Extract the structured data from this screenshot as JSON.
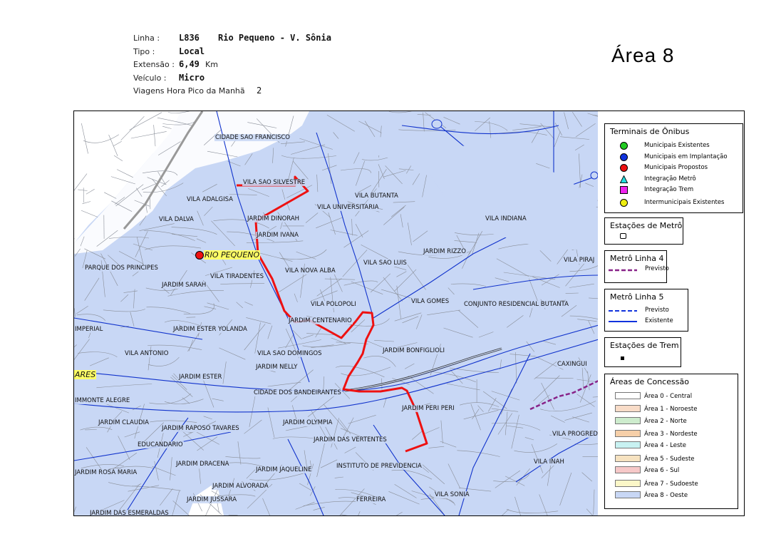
{
  "header": {
    "linha_label": "Linha :",
    "linha_code": "L836",
    "linha_name": "Rio Pequeno -  V. Sônia",
    "tipo_label": "Tipo :",
    "tipo_value": "Local",
    "extensao_label": "Extensão :",
    "extensao_value": "6,49",
    "extensao_unit": "Km",
    "veiculo_label": "Veículo :",
    "veiculo_value": "Micro",
    "viagens_label": "Viagens Hora Pico da Manhã",
    "viagens_value": "2"
  },
  "area_title": "Área  8",
  "map": {
    "route_color": "#ee1111",
    "water_color": "#c8d7f5",
    "labels": {
      "cidade_sao_francisco": "CIDADE SAO FRANCISCO",
      "vila_sao_silvestre": "VILA SAO SILVESTRE",
      "vila_adalgisa": "VILA ADALGISA",
      "vila_butanta": "VILA BUTANTA",
      "vila_universitaria": "VILA UNIVERSITARIA",
      "vila_dalva": "VILA DALVA",
      "jardim_dinorah": "JARDIM DINORAH",
      "vila_indiana": "VILA INDIANA",
      "jardim_ivana": "JARDIM IVANA",
      "jardim_rizzo": "JARDIM RIZZO",
      "rio_pequeno": "RIO PEQUENO",
      "vila_pirajussara": "VILA PIRAJ",
      "parque_dos_principes": "PARQUE DOS PRINCIPES",
      "vila_nova_alba": "VILA NOVA ALBA",
      "vila_sao_luis": "VILA SAO LUIS",
      "vila_tiradentes": "VILA TIRADENTES",
      "jardim_sarah": "JARDIM SARAH",
      "vila_polopoli": "VILA POLOPOLI",
      "vila_gomes": "VILA GOMES",
      "conjunto_butanta": "CONJUNTO RESIDENCIAL BUTANTA",
      "imperial": "IMPERIAL",
      "jardim_ester_yolanda": "JARDIM ESTER YOLANDA",
      "jardim_centenario": "JARDIM CENTENARIO",
      "vila_antonio": "VILA ANTONIO",
      "vila_sao_domingos": "VILA SAO DOMINGOS",
      "jardim_bonfiglioli": "JARDIM BONFIGLIOLI",
      "jardim_nelly": "JARDIM NELLY",
      "caxingui": "CAXINGUI",
      "tavares": "ARES",
      "jardim_ester": "JARDIM ESTER",
      "cidade_dos_bandeirantes": "CIDADE DOS BANDEIRANTES",
      "monte_alegre": "IMMONTE ALEGRE",
      "jardim_peri_peri": "JARDIM PERI PERI",
      "jardim_claudia": "JARDIM CLAUDIA",
      "jardim_raposo_tavares": "JARDIM RAPOSO TAVARES",
      "jardim_olympia": "JARDIM OLYMPIA",
      "vila_progredior": "VILA PROGRED",
      "educandario": "EDUCANDARIO",
      "jardim_das_vertentes": "JARDIM DAS VERTENTES",
      "jardim_dracena": "JARDIM DRACENA",
      "vila_inah": "VILA INAH",
      "jardim_rosa_maria": "JARDIM ROSA MARIA",
      "jardim_jaqueline": "JARDIM JAQUELINE",
      "instituto_previdencia": "INSTITUTO DE PREVIDENCIA",
      "jardim_alvorada": "JARDIM ALVORADA",
      "vila_sonia": "VILA SONIA",
      "jardim_jussara": "JARDIM JUSSARA",
      "ferreira": "FERREIRA",
      "jardim_das_esmeraldas": "JARDIM DAS ESMERALDAS"
    }
  },
  "legend": {
    "terminais": {
      "title": "Terminais de Ônibus",
      "items": [
        {
          "label": "Municipais Existentes",
          "color": "#22cc22",
          "icon": "circle-icon"
        },
        {
          "label": "Municipais em Implantação",
          "color": "#1133dd",
          "icon": "circle-icon"
        },
        {
          "label": "Municipais Propostos",
          "color": "#ee1111",
          "icon": "circle-icon"
        },
        {
          "label": "Integração Metrô",
          "color": "#22dddd",
          "icon": "triangle-icon"
        },
        {
          "label": "Integração Trem",
          "color": "#ee22ee",
          "icon": "square-icon"
        },
        {
          "label": "Intermunicipais Existentes",
          "color": "#eeee11",
          "icon": "circle-icon"
        }
      ]
    },
    "estacoes_metro": {
      "title": "Estações de Metrô"
    },
    "metro_linha4": {
      "title": "Metrô Linha 4",
      "items": [
        {
          "label": "Previsto",
          "color": "#882288"
        }
      ]
    },
    "metro_linha5": {
      "title": "Metrô Linha 5",
      "items": [
        {
          "label": "Previsto",
          "color": "#1133dd"
        },
        {
          "label": "Existente",
          "color": "#1133dd"
        }
      ]
    },
    "estacoes_trem": {
      "title": "Estações de Trem"
    },
    "areas": {
      "title": "Áreas de Concessão",
      "items": [
        {
          "label": "Área 0 - Central",
          "color": "#ffffff"
        },
        {
          "label": "Área 1 - Noroeste",
          "color": "#f8dcc8"
        },
        {
          "label": "Área 2 - Norte",
          "color": "#cdeccd"
        },
        {
          "label": "Área 3 - Nordeste",
          "color": "#f6cfa8"
        },
        {
          "label": "Área 4 - Leste",
          "color": "#c8f2f2"
        },
        {
          "label": "Área 5 - Sudeste",
          "color": "#f6e2c0"
        },
        {
          "label": "Área 6 - Sul",
          "color": "#f6c8c8"
        },
        {
          "label": "Área 7 - Sudoeste",
          "color": "#fbf7c8"
        },
        {
          "label": "Área 8 - Oeste",
          "color": "#c8d7f5"
        }
      ]
    }
  }
}
